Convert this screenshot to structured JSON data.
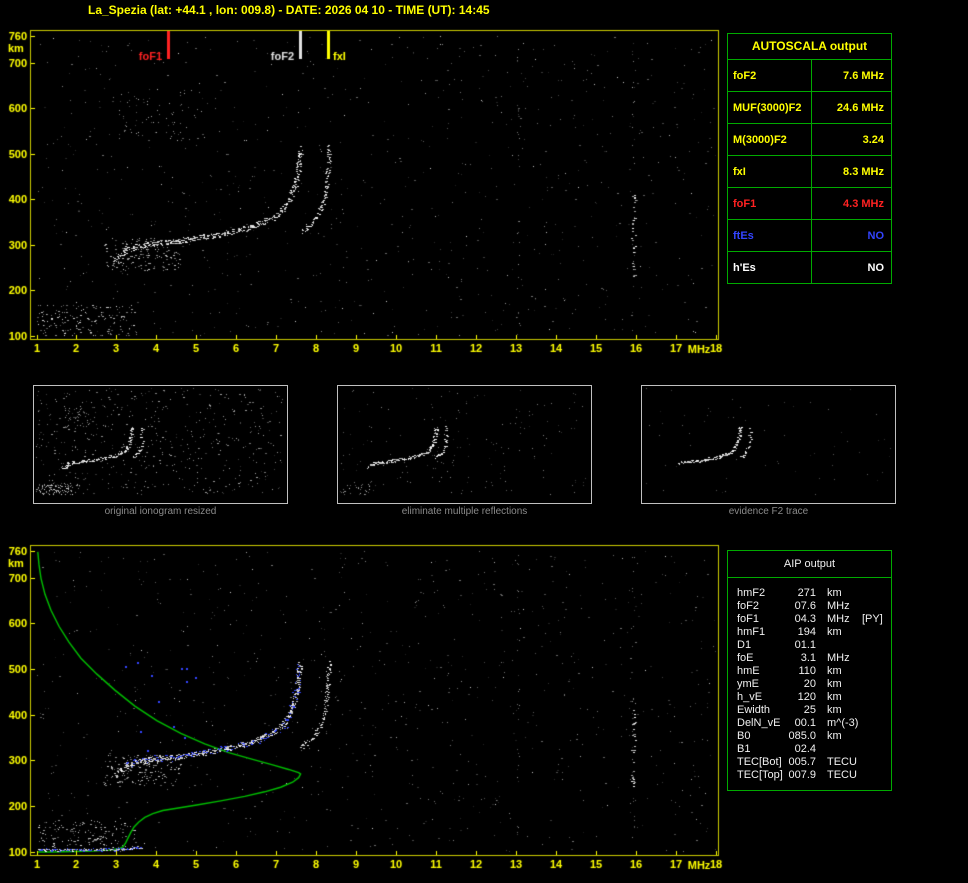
{
  "title": "La_Spezia (lat: +44.1 , lon: 009.8) - DATE: 2026 04 10 - TIME (UT): 14:45",
  "colors": {
    "background": "#000000",
    "axis_yellow": "#ffff00",
    "plot_border": "#cccc00",
    "table_border": "#00aa00",
    "red": "#ff2222",
    "blue": "#3344ff",
    "white": "#ffffff",
    "profile_green": "#00c000",
    "trace_blue": "#3344ff",
    "caption_gray": "#8a8a8a"
  },
  "autoscala": {
    "header": "AUTOSCALA output",
    "rows": [
      {
        "label": "foF2",
        "value": "7.6 MHz",
        "color": "#ffff00"
      },
      {
        "label": "MUF(3000)F2",
        "value": "24.6 MHz",
        "color": "#ffff00"
      },
      {
        "label": "M(3000)F2",
        "value": "3.24",
        "color": "#ffff00"
      },
      {
        "label": "fxI",
        "value": "8.3 MHz",
        "color": "#ffff00"
      },
      {
        "label": "foF1",
        "value": "4.3 MHz",
        "color": "#ff2222"
      },
      {
        "label": "ftEs",
        "value": "NO",
        "color": "#3344ff"
      },
      {
        "label": "h'Es",
        "value": "NO",
        "color": "#ffffff"
      }
    ]
  },
  "aip": {
    "header": "AIP output",
    "rows": [
      {
        "name": "hmF2",
        "value": "271",
        "unit": "km",
        "extra": ""
      },
      {
        "name": "foF2",
        "value": "07.6",
        "unit": "MHz",
        "extra": ""
      },
      {
        "name": "foF1",
        "value": "04.3",
        "unit": "MHz",
        "extra": "[PY]"
      },
      {
        "name": "hmF1",
        "value": "194",
        "unit": "km",
        "extra": ""
      },
      {
        "name": "D1",
        "value": "01.1",
        "unit": "",
        "extra": ""
      },
      {
        "name": "foE",
        "value": "3.1",
        "unit": "MHz",
        "extra": ""
      },
      {
        "name": "hmE",
        "value": "110",
        "unit": "km",
        "extra": ""
      },
      {
        "name": "ymE",
        "value": "20",
        "unit": "km",
        "extra": ""
      },
      {
        "name": "h_vE",
        "value": "120",
        "unit": "km",
        "extra": ""
      },
      {
        "name": "Ewidth",
        "value": "25",
        "unit": "km",
        "extra": ""
      },
      {
        "name": "DelN_vE",
        "value": "00.1",
        "unit": "m^(-3)",
        "extra": ""
      },
      {
        "name": "B0",
        "value": "085.0",
        "unit": "km",
        "extra": ""
      },
      {
        "name": "B1",
        "value": "02.4",
        "unit": "",
        "extra": ""
      },
      {
        "name": "TEC[Bot]",
        "value": "005.7",
        "unit": "TECU",
        "extra": ""
      },
      {
        "name": "TEC[Top]",
        "value": "007.9",
        "unit": "TECU",
        "extra": ""
      }
    ]
  },
  "thumbnails": [
    {
      "caption": "original ionogram resized"
    },
    {
      "caption": "eliminate multiple reflections"
    },
    {
      "caption": "evidence F2 trace"
    }
  ],
  "chart_data": [
    {
      "id": "autoscaled_ionogram",
      "type": "scatter",
      "title": "",
      "xlabel": "MHz",
      "ylabel": "km",
      "xlim": [
        1,
        18
      ],
      "ylim": [
        100,
        760
      ],
      "grid": false,
      "xticks": [
        1,
        2,
        3,
        4,
        5,
        6,
        7,
        8,
        9,
        10,
        11,
        12,
        13,
        14,
        15,
        16,
        17,
        18
      ],
      "yticks": [
        760,
        700,
        600,
        500,
        400,
        300,
        200,
        100
      ],
      "markers": [
        {
          "label": "foF1",
          "freq": 4.3,
          "color": "#ff2222",
          "align": "right"
        },
        {
          "label": "foF2",
          "freq": 7.6,
          "color": "#e0e0e0",
          "align": "right"
        },
        {
          "label": "fxI",
          "freq": 8.3,
          "color": "#ffff00",
          "align": "left"
        }
      ],
      "o_trace": [
        [
          2.95,
          268
        ],
        [
          3.1,
          280
        ],
        [
          3.25,
          290
        ],
        [
          3.45,
          296
        ],
        [
          3.7,
          300
        ],
        [
          4.0,
          303
        ],
        [
          4.3,
          306
        ],
        [
          4.6,
          309
        ],
        [
          4.9,
          313
        ],
        [
          5.2,
          317
        ],
        [
          5.5,
          322
        ],
        [
          5.8,
          327
        ],
        [
          6.1,
          333
        ],
        [
          6.4,
          341
        ],
        [
          6.7,
          351
        ],
        [
          6.95,
          362
        ],
        [
          7.15,
          377
        ],
        [
          7.3,
          396
        ],
        [
          7.42,
          420
        ],
        [
          7.5,
          448
        ],
        [
          7.55,
          475
        ],
        [
          7.58,
          500
        ],
        [
          7.6,
          512
        ]
      ],
      "x_trace": [
        [
          7.62,
          330
        ],
        [
          7.75,
          338
        ],
        [
          7.9,
          349
        ],
        [
          8.02,
          363
        ],
        [
          8.12,
          382
        ],
        [
          8.2,
          405
        ],
        [
          8.25,
          432
        ],
        [
          8.28,
          462
        ],
        [
          8.3,
          492
        ],
        [
          8.31,
          515
        ]
      ]
    },
    {
      "id": "ionogram_with_density_profile",
      "type": "scatter",
      "title": "",
      "xlabel": "MHz",
      "ylabel": "km",
      "xlim": [
        1,
        18
      ],
      "ylim": [
        100,
        760
      ],
      "grid": false,
      "xticks": [
        1,
        2,
        3,
        4,
        5,
        6,
        7,
        8,
        9,
        10,
        11,
        12,
        13,
        14,
        15,
        16,
        17,
        18
      ],
      "yticks": [
        760,
        700,
        600,
        500,
        400,
        300,
        200,
        100
      ],
      "markers": [],
      "o_trace": [
        [
          2.95,
          268
        ],
        [
          3.1,
          280
        ],
        [
          3.25,
          290
        ],
        [
          3.45,
          296
        ],
        [
          3.7,
          300
        ],
        [
          4.0,
          303
        ],
        [
          4.3,
          306
        ],
        [
          4.6,
          309
        ],
        [
          4.9,
          313
        ],
        [
          5.2,
          317
        ],
        [
          5.5,
          322
        ],
        [
          5.8,
          327
        ],
        [
          6.1,
          333
        ],
        [
          6.4,
          341
        ],
        [
          6.7,
          351
        ],
        [
          6.95,
          362
        ],
        [
          7.15,
          377
        ],
        [
          7.3,
          396
        ],
        [
          7.42,
          420
        ],
        [
          7.5,
          448
        ],
        [
          7.55,
          475
        ],
        [
          7.58,
          500
        ],
        [
          7.6,
          512
        ]
      ],
      "x_trace": [
        [
          7.62,
          330
        ],
        [
          7.75,
          338
        ],
        [
          7.9,
          349
        ],
        [
          8.02,
          363
        ],
        [
          8.12,
          382
        ],
        [
          8.2,
          405
        ],
        [
          8.25,
          432
        ],
        [
          8.28,
          462
        ],
        [
          8.3,
          492
        ],
        [
          8.31,
          515
        ]
      ],
      "profile": [
        [
          1.02,
          758
        ],
        [
          1.05,
          730
        ],
        [
          1.1,
          700
        ],
        [
          1.2,
          665
        ],
        [
          1.35,
          630
        ],
        [
          1.55,
          595
        ],
        [
          1.8,
          560
        ],
        [
          2.1,
          525
        ],
        [
          2.5,
          490
        ],
        [
          2.95,
          455
        ],
        [
          3.45,
          420
        ],
        [
          4.0,
          388
        ],
        [
          4.6,
          360
        ],
        [
          5.2,
          337
        ],
        [
          5.8,
          318
        ],
        [
          6.4,
          303
        ],
        [
          6.9,
          291
        ],
        [
          7.3,
          281
        ],
        [
          7.55,
          274
        ],
        [
          7.6,
          271
        ],
        [
          7.55,
          263
        ],
        [
          7.4,
          253
        ],
        [
          7.1,
          242
        ],
        [
          6.7,
          232
        ],
        [
          6.2,
          222
        ],
        [
          5.6,
          212
        ],
        [
          5.0,
          203
        ],
        [
          4.5,
          196
        ],
        [
          4.15,
          191
        ],
        [
          3.9,
          184
        ],
        [
          3.7,
          176
        ],
        [
          3.55,
          166
        ],
        [
          3.43,
          155
        ],
        [
          3.35,
          143
        ],
        [
          3.28,
          131
        ],
        [
          3.22,
          120
        ],
        [
          3.15,
          111
        ],
        [
          3.05,
          107
        ],
        [
          2.8,
          104
        ],
        [
          2.4,
          102
        ],
        [
          1.9,
          101
        ],
        [
          1.4,
          100
        ],
        [
          1.02,
          100
        ]
      ],
      "restored_trace": [
        [
          1.05,
          104
        ],
        [
          1.4,
          104
        ],
        [
          1.8,
          104
        ],
        [
          2.2,
          104
        ],
        [
          2.6,
          105
        ],
        [
          2.9,
          105
        ],
        [
          3.15,
          106
        ],
        [
          3.4,
          108
        ],
        [
          3.6,
          110
        ]
      ]
    }
  ]
}
